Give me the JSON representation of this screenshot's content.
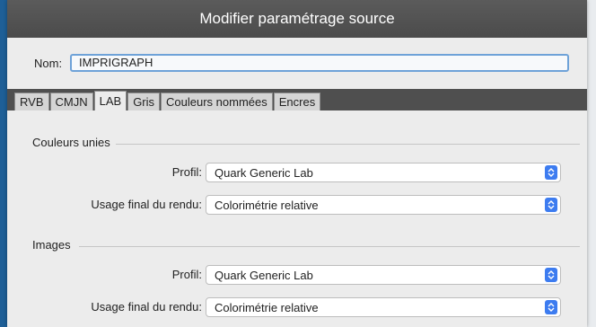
{
  "window": {
    "title": "Modifier paramétrage source"
  },
  "name": {
    "label": "Nom:",
    "value": "IMPRIGRAPH"
  },
  "tabs": [
    {
      "label": "RVB",
      "active": false
    },
    {
      "label": "CMJN",
      "active": false
    },
    {
      "label": "LAB",
      "active": true
    },
    {
      "label": "Gris",
      "active": false
    },
    {
      "label": "Couleurs nommées",
      "active": false
    },
    {
      "label": "Encres",
      "active": false
    }
  ],
  "sections": {
    "solid": {
      "heading": "Couleurs unies",
      "profile_label": "Profil:",
      "profile_value": "Quark Generic Lab",
      "intent_label": "Usage final du rendu:",
      "intent_value": "Colorimétrie relative"
    },
    "images": {
      "heading": "Images",
      "profile_label": "Profil:",
      "profile_value": "Quark Generic Lab",
      "intent_label": "Usage final du rendu:",
      "intent_value": "Colorimétrie relative"
    }
  },
  "colors": {
    "accent": "#3d7cf0",
    "titlebar": "#4b4b4b",
    "background": "#1e5f97"
  }
}
